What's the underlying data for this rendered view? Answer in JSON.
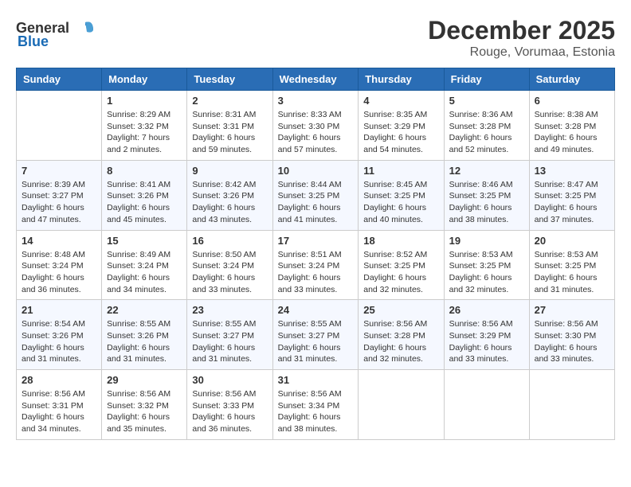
{
  "logo": {
    "text_general": "General",
    "text_blue": "Blue"
  },
  "title": {
    "month": "December 2025",
    "location": "Rouge, Vorumaa, Estonia"
  },
  "weekdays": [
    "Sunday",
    "Monday",
    "Tuesday",
    "Wednesday",
    "Thursday",
    "Friday",
    "Saturday"
  ],
  "weeks": [
    [
      {
        "day": "",
        "detail": ""
      },
      {
        "day": "1",
        "detail": "Sunrise: 8:29 AM\nSunset: 3:32 PM\nDaylight: 7 hours\nand 2 minutes."
      },
      {
        "day": "2",
        "detail": "Sunrise: 8:31 AM\nSunset: 3:31 PM\nDaylight: 6 hours\nand 59 minutes."
      },
      {
        "day": "3",
        "detail": "Sunrise: 8:33 AM\nSunset: 3:30 PM\nDaylight: 6 hours\nand 57 minutes."
      },
      {
        "day": "4",
        "detail": "Sunrise: 8:35 AM\nSunset: 3:29 PM\nDaylight: 6 hours\nand 54 minutes."
      },
      {
        "day": "5",
        "detail": "Sunrise: 8:36 AM\nSunset: 3:28 PM\nDaylight: 6 hours\nand 52 minutes."
      },
      {
        "day": "6",
        "detail": "Sunrise: 8:38 AM\nSunset: 3:28 PM\nDaylight: 6 hours\nand 49 minutes."
      }
    ],
    [
      {
        "day": "7",
        "detail": "Sunrise: 8:39 AM\nSunset: 3:27 PM\nDaylight: 6 hours\nand 47 minutes."
      },
      {
        "day": "8",
        "detail": "Sunrise: 8:41 AM\nSunset: 3:26 PM\nDaylight: 6 hours\nand 45 minutes."
      },
      {
        "day": "9",
        "detail": "Sunrise: 8:42 AM\nSunset: 3:26 PM\nDaylight: 6 hours\nand 43 minutes."
      },
      {
        "day": "10",
        "detail": "Sunrise: 8:44 AM\nSunset: 3:25 PM\nDaylight: 6 hours\nand 41 minutes."
      },
      {
        "day": "11",
        "detail": "Sunrise: 8:45 AM\nSunset: 3:25 PM\nDaylight: 6 hours\nand 40 minutes."
      },
      {
        "day": "12",
        "detail": "Sunrise: 8:46 AM\nSunset: 3:25 PM\nDaylight: 6 hours\nand 38 minutes."
      },
      {
        "day": "13",
        "detail": "Sunrise: 8:47 AM\nSunset: 3:25 PM\nDaylight: 6 hours\nand 37 minutes."
      }
    ],
    [
      {
        "day": "14",
        "detail": "Sunrise: 8:48 AM\nSunset: 3:24 PM\nDaylight: 6 hours\nand 36 minutes."
      },
      {
        "day": "15",
        "detail": "Sunrise: 8:49 AM\nSunset: 3:24 PM\nDaylight: 6 hours\nand 34 minutes."
      },
      {
        "day": "16",
        "detail": "Sunrise: 8:50 AM\nSunset: 3:24 PM\nDaylight: 6 hours\nand 33 minutes."
      },
      {
        "day": "17",
        "detail": "Sunrise: 8:51 AM\nSunset: 3:24 PM\nDaylight: 6 hours\nand 33 minutes."
      },
      {
        "day": "18",
        "detail": "Sunrise: 8:52 AM\nSunset: 3:25 PM\nDaylight: 6 hours\nand 32 minutes."
      },
      {
        "day": "19",
        "detail": "Sunrise: 8:53 AM\nSunset: 3:25 PM\nDaylight: 6 hours\nand 32 minutes."
      },
      {
        "day": "20",
        "detail": "Sunrise: 8:53 AM\nSunset: 3:25 PM\nDaylight: 6 hours\nand 31 minutes."
      }
    ],
    [
      {
        "day": "21",
        "detail": "Sunrise: 8:54 AM\nSunset: 3:26 PM\nDaylight: 6 hours\nand 31 minutes."
      },
      {
        "day": "22",
        "detail": "Sunrise: 8:55 AM\nSunset: 3:26 PM\nDaylight: 6 hours\nand 31 minutes."
      },
      {
        "day": "23",
        "detail": "Sunrise: 8:55 AM\nSunset: 3:27 PM\nDaylight: 6 hours\nand 31 minutes."
      },
      {
        "day": "24",
        "detail": "Sunrise: 8:55 AM\nSunset: 3:27 PM\nDaylight: 6 hours\nand 31 minutes."
      },
      {
        "day": "25",
        "detail": "Sunrise: 8:56 AM\nSunset: 3:28 PM\nDaylight: 6 hours\nand 32 minutes."
      },
      {
        "day": "26",
        "detail": "Sunrise: 8:56 AM\nSunset: 3:29 PM\nDaylight: 6 hours\nand 33 minutes."
      },
      {
        "day": "27",
        "detail": "Sunrise: 8:56 AM\nSunset: 3:30 PM\nDaylight: 6 hours\nand 33 minutes."
      }
    ],
    [
      {
        "day": "28",
        "detail": "Sunrise: 8:56 AM\nSunset: 3:31 PM\nDaylight: 6 hours\nand 34 minutes."
      },
      {
        "day": "29",
        "detail": "Sunrise: 8:56 AM\nSunset: 3:32 PM\nDaylight: 6 hours\nand 35 minutes."
      },
      {
        "day": "30",
        "detail": "Sunrise: 8:56 AM\nSunset: 3:33 PM\nDaylight: 6 hours\nand 36 minutes."
      },
      {
        "day": "31",
        "detail": "Sunrise: 8:56 AM\nSunset: 3:34 PM\nDaylight: 6 hours\nand 38 minutes."
      },
      {
        "day": "",
        "detail": ""
      },
      {
        "day": "",
        "detail": ""
      },
      {
        "day": "",
        "detail": ""
      }
    ]
  ]
}
